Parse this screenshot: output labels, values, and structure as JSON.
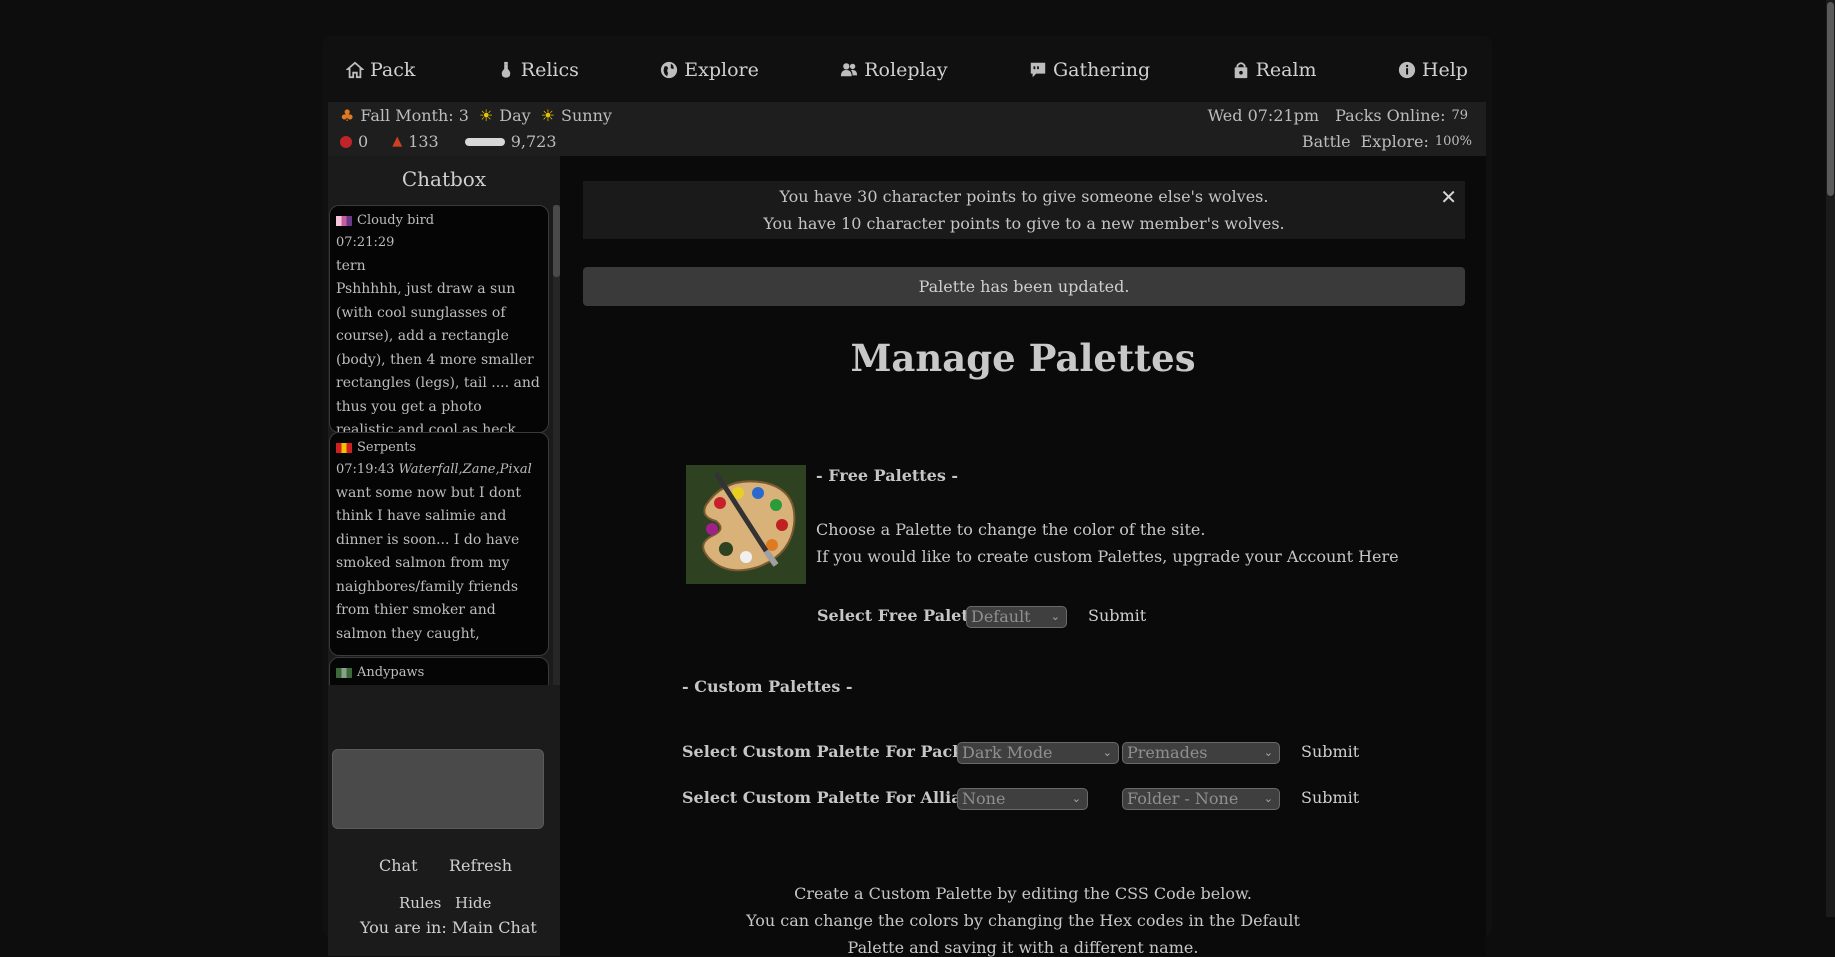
{
  "nav": [
    {
      "label": "Pack",
      "icon": "home-icon"
    },
    {
      "label": "Relics",
      "icon": "potion-icon"
    },
    {
      "label": "Explore",
      "icon": "globe-icon"
    },
    {
      "label": "Roleplay",
      "icon": "users-icon"
    },
    {
      "label": "Gathering",
      "icon": "chat-bubble-icon"
    },
    {
      "label": "Realm",
      "icon": "shopping-bag-icon"
    },
    {
      "label": "Help",
      "icon": "info-icon"
    }
  ],
  "status": {
    "season": "Fall Month: 3",
    "time_of_day": "Day",
    "weather": "Sunny",
    "apples": "0",
    "mushrooms": "133",
    "bones": "9,723",
    "datetime": "Wed 07:21pm",
    "packs_online_label": "Packs Online:",
    "packs_online": "79",
    "battle_label": "Battle",
    "explore_label": "Explore:",
    "explore_value": "100%"
  },
  "chat": {
    "title": "Chatbox",
    "messages": [
      {
        "user": "Cloudy bird",
        "time": "07:21:29",
        "tags": "",
        "text": "tern",
        "text2": "Pshhhhh, just draw a sun (with cool sunglasses of course), add a rectangle (body), then 4 more smaller rectangles (legs), tail .... and thus you get a photo realistic and cool as heck lion"
      },
      {
        "user": "Serpents",
        "time": "07:19:43",
        "tags": "Waterfall,Zane,Pixal",
        "text": "want some now but I dont think I have salimie and dinner is soon... I do have smoked salmon from my naighbores/family friends from thier smoker and salmon they caught,",
        "text2": ""
      },
      {
        "user": "Andypaws",
        "time": "",
        "tags": "",
        "text": "",
        "text2": ""
      }
    ],
    "chat_button": "Chat",
    "refresh_button": "Refresh",
    "rules_link": "Rules",
    "hide_link": "Hide",
    "location": "You are in: Main Chat"
  },
  "main": {
    "notice_line1": "You have 30 character points to give someone else's wolves.",
    "notice_line2": "You have 10 character points to give to a new member's wolves.",
    "updated_message": "Palette has been updated.",
    "title": "Manage Palettes",
    "free_heading": "- Free Palettes -",
    "free_desc1": "Choose a Palette to change the color of the site.",
    "free_desc2": "If you would like to create custom Palettes, upgrade your Account Here",
    "select_free_label": "Select Free Palette",
    "free_palette_value": "Default",
    "submit_label": "Submit",
    "custom_heading": "- Custom Palettes -",
    "pack_label": "Select Custom Palette For Pack",
    "pack_palette_value": "Dark Mode",
    "pack_folder_value": "Premades",
    "alliance_label": "Select Custom Palette For Alliance",
    "alliance_palette_value": "None",
    "alliance_folder_value": "Folder - None",
    "css_line1": "Create a Custom Palette by editing the CSS Code below.",
    "css_line2": "You can change the colors by changing the Hex codes in the Default",
    "css_line3": "Palette and saving it with a different name."
  },
  "colors": {
    "background": "#0d0d0d",
    "panel": "#1b1b1b",
    "text": "#c9c9c9"
  }
}
